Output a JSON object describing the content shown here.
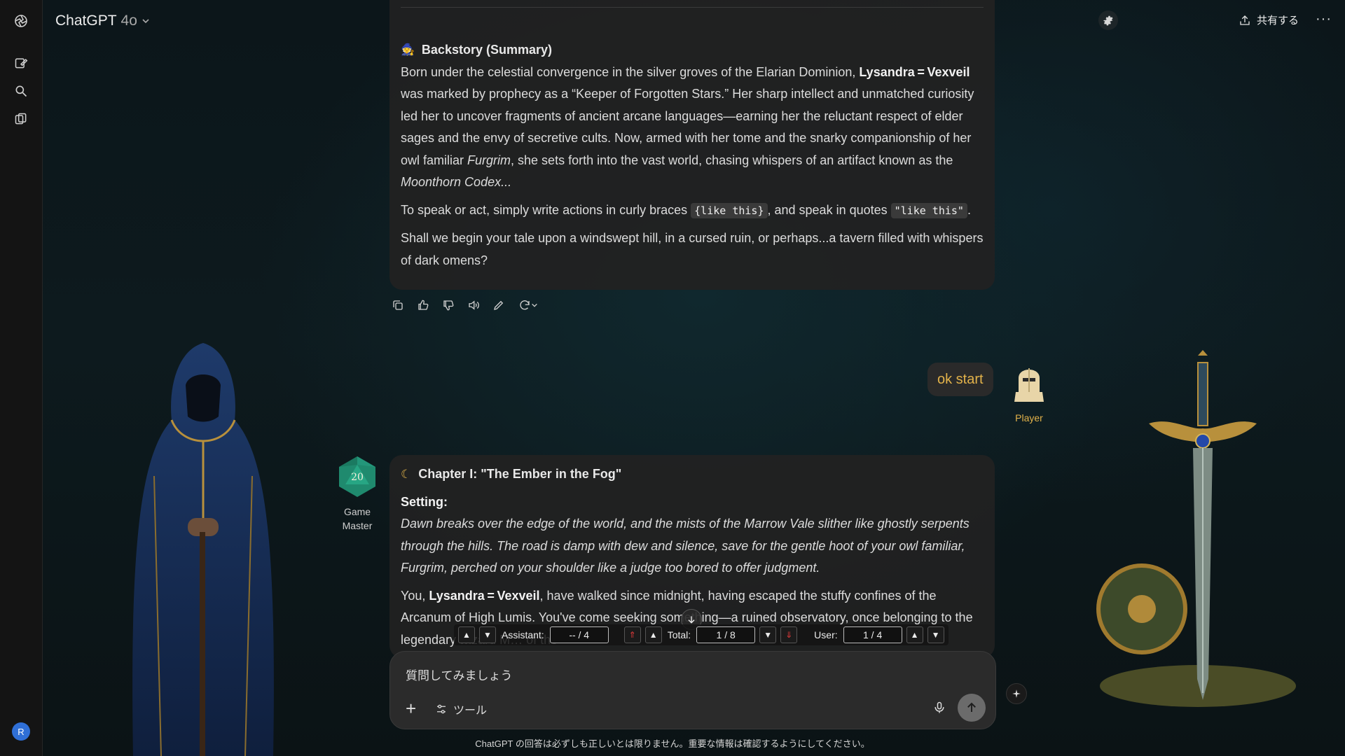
{
  "header": {
    "app_name": "ChatGPT",
    "model": "4o",
    "share_label": "共有する",
    "more_label": "···"
  },
  "sidebar": {
    "avatar_initial": "R"
  },
  "message1": {
    "backstory_heading": "Backstory (Summary)",
    "p1": {
      "a": "Born under the celestial convergence in the silver groves of the Elarian Dominion, ",
      "name": "Lysandra = Vexveil",
      "b": " was marked by prophecy as a “Keeper of Forgotten Stars.” Her sharp intellect and unmatched curiosity led her to uncover fragments of ancient arcane languages—earning her the reluctant respect of elder sages and the envy of secretive cults. Now, armed with her tome and the snarky companionship of her owl familiar ",
      "owl": "Furgrim",
      "c": ", she sets forth into the vast world, chasing whispers of an artifact known as the ",
      "codex": "Moonthorn Codex",
      "d": "..."
    },
    "p2": {
      "a": "To speak or act, simply write actions in curly braces ",
      "code1": "{like this}",
      "b": ", and speak in quotes ",
      "code2": "\"like this\"",
      "c": "."
    },
    "p3": "Shall we begin your tale upon a windswept hill, in a cursed ruin, or perhaps...a tavern filled with whispers of dark omens?"
  },
  "user_message": {
    "text": "ok start",
    "avatar_label": "Player"
  },
  "game_master": {
    "die_value": "20",
    "label_line1": "Game",
    "label_line2": "Master"
  },
  "message2": {
    "chapter_heading": "Chapter I: \"The Ember in the Fog\"",
    "setting_label": "Setting:",
    "setting_text": "Dawn breaks over the edge of the world, and the mists of the Marrow Vale slither like ghostly serpents through the hills. The road is damp with dew and silence, save for the gentle hoot of your owl familiar, Furgrim, perched on your shoulder like a judge too bored to offer judgment.",
    "p2a": "You, ",
    "p2name": "Lysandra = Vexveil",
    "p2b": ", have walked since midnight, having escaped the stuffy confines of the Arcanum of High Lumis. You've come seeking something—a ruined observatory, once belonging to the legendary wizard M… of the"
  },
  "navigator": {
    "assistant_label": "Assistant:",
    "assistant_value": "-- / 4",
    "total_label": "Total:",
    "total_value": "1 / 8",
    "user_label": "User:",
    "user_value": "1 / 4"
  },
  "composer": {
    "placeholder": "質問してみましょう",
    "tools_label": "ツール"
  },
  "disclaimer": "ChatGPT の回答は必ずしも正しいとは限りません。重要な情報は確認するようにしてください。",
  "colors": {
    "accent_gold": "#e2b24a",
    "bubble_bg": "#222222",
    "background": "#0d1a1e"
  }
}
